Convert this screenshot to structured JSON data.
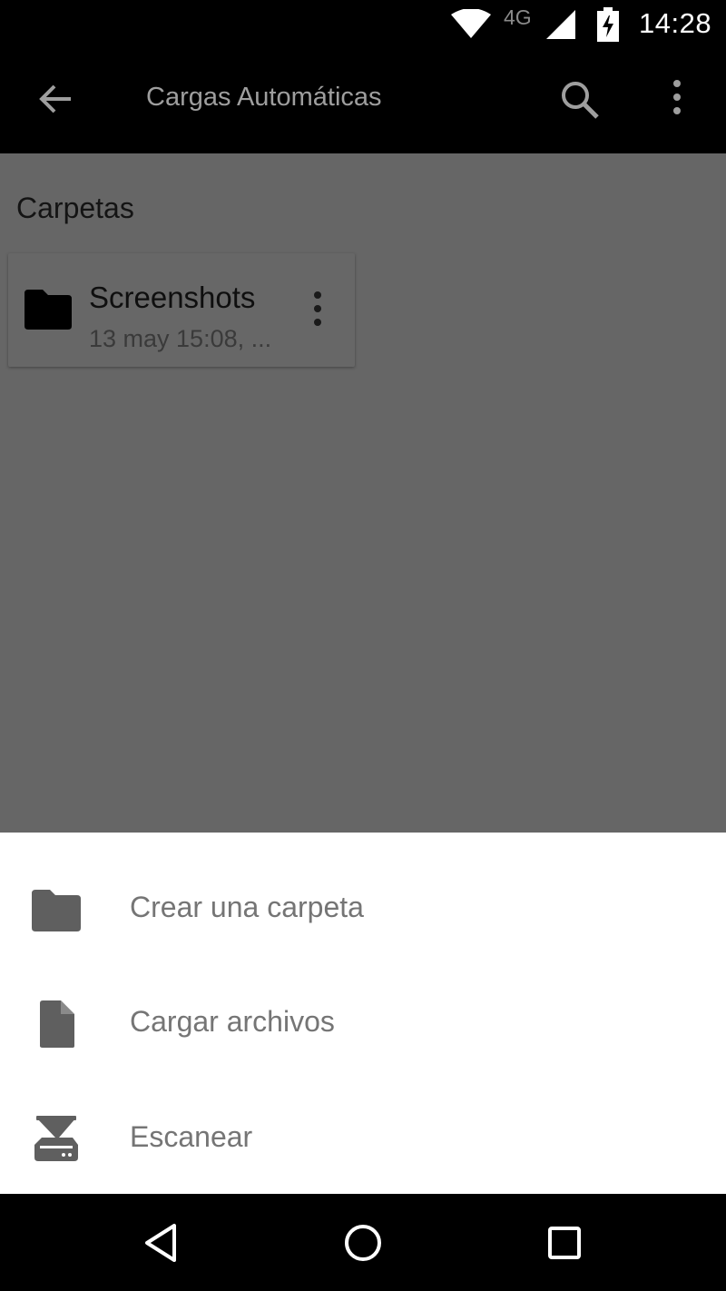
{
  "status_bar": {
    "network": "4G",
    "time": "14:28"
  },
  "app_bar": {
    "title": "Cargas Automáticas"
  },
  "content": {
    "section_label": "Carpetas",
    "folders": [
      {
        "name": "Screenshots",
        "meta": "13 may 15:08, ..."
      }
    ]
  },
  "bottom_sheet": {
    "items": [
      {
        "label": "Crear una carpeta",
        "icon": "folder-icon"
      },
      {
        "label": "Cargar archivos",
        "icon": "file-icon"
      },
      {
        "label": "Escanear",
        "icon": "scanner-icon"
      }
    ]
  },
  "colors": {
    "scrim": "#666666",
    "sheet_background": "#ffffff",
    "sheet_text": "#757575",
    "bar_background": "#000000"
  }
}
